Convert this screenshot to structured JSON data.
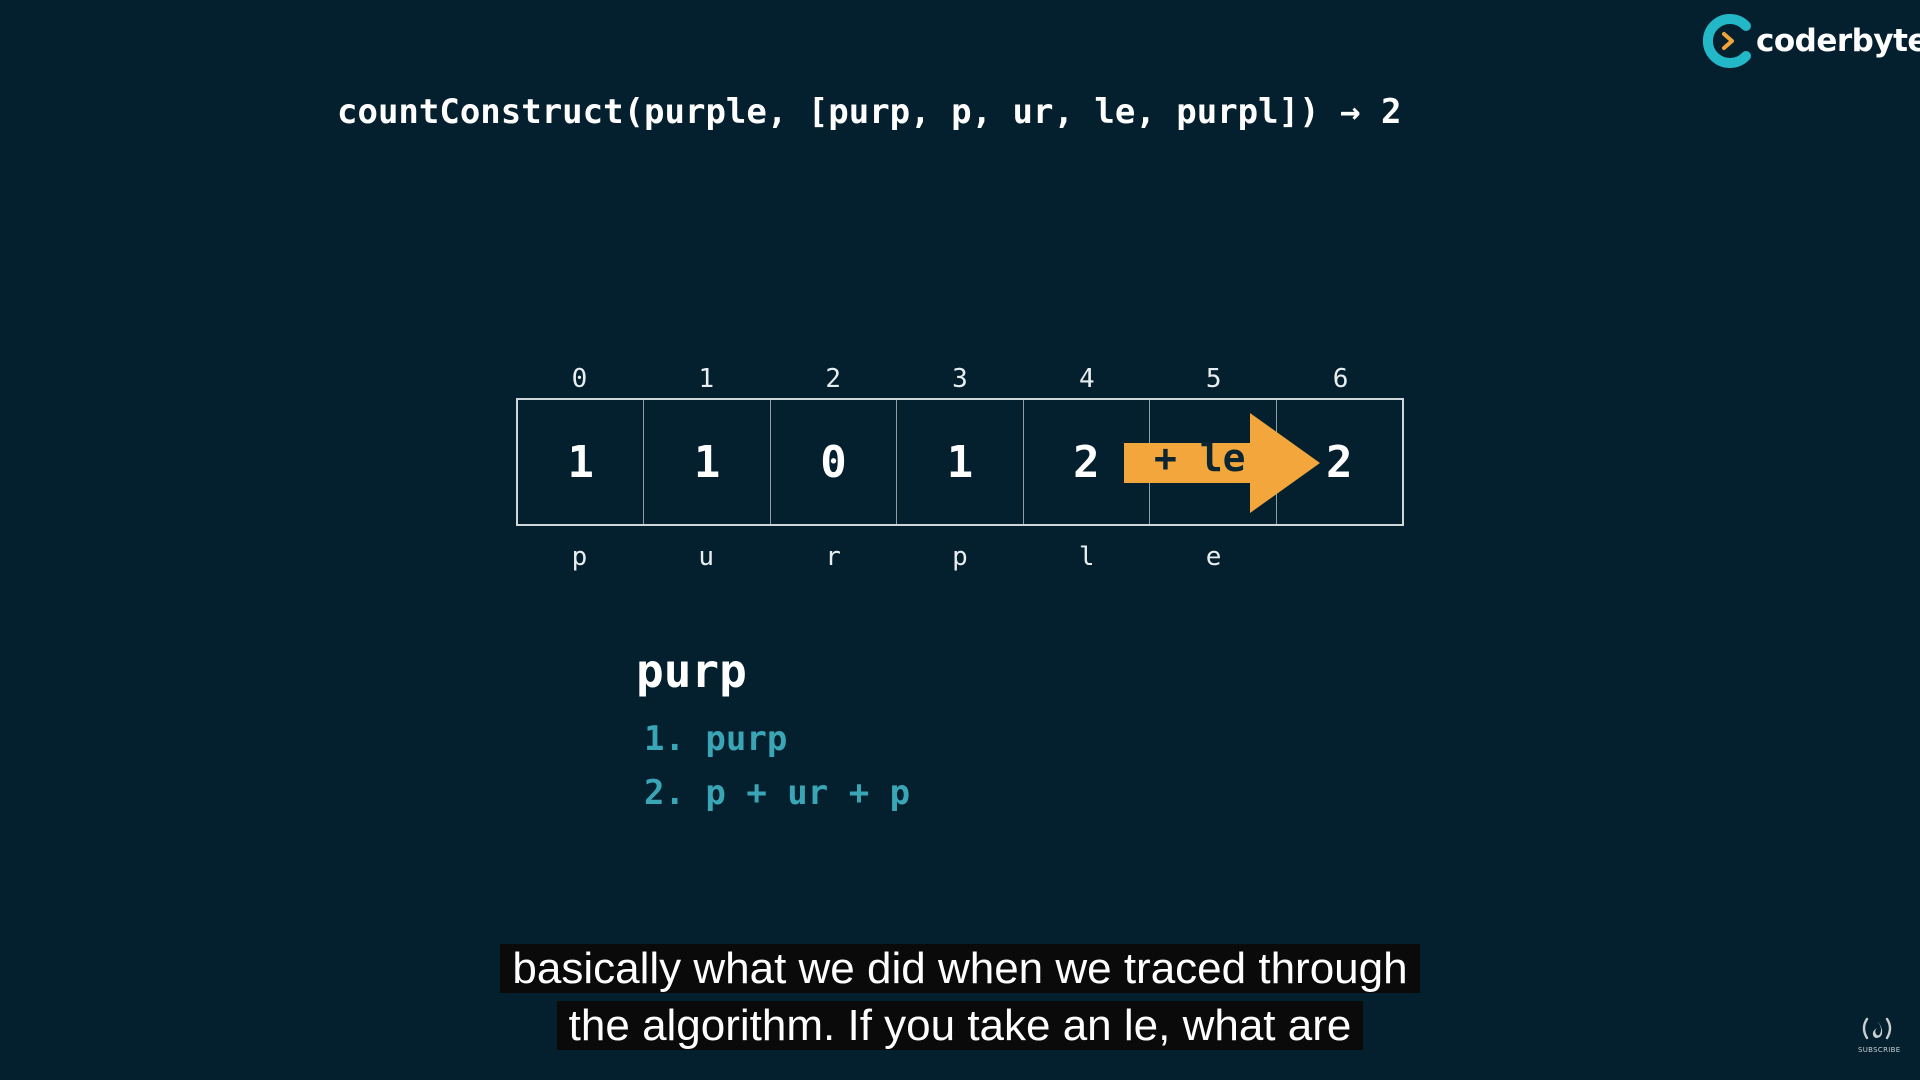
{
  "brand": {
    "name": "coderbyte",
    "accent": "#22b8c8",
    "mark_accent": "#f2a33a"
  },
  "formula": "countConstruct(purple, [purp, p, ur, le, purpl]) → 2",
  "table": {
    "indices": [
      "0",
      "1",
      "2",
      "3",
      "4",
      "5",
      "6"
    ],
    "values": [
      "1",
      "1",
      "0",
      "1",
      "2",
      "",
      "2"
    ],
    "chars": [
      "p",
      "u",
      "r",
      "p",
      "l",
      "e"
    ],
    "arrow_label": "+ le",
    "arrow_color": "#f2a63b"
  },
  "word": {
    "title": "purp",
    "ways": [
      "1. purp",
      "2. p + ur + p"
    ]
  },
  "caption": {
    "line1": "basically what we did when we traced through",
    "line2": "the algorithm. If you take an le, what are"
  },
  "corner_logo": {
    "label": "SUBSCRIBE",
    "icon": "freecodecamp-icon"
  }
}
